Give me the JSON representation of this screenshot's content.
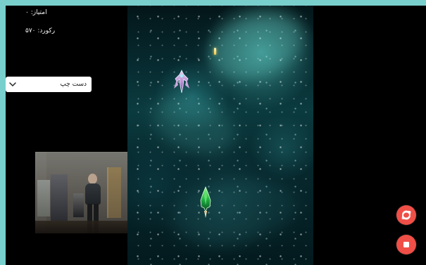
{
  "hud": {
    "score_text": "امتیاز: ۰",
    "record_text": "رکورد: ۵۷۰"
  },
  "controls": {
    "hand_selector": {
      "selected": "دست چپ"
    }
  },
  "icons": {
    "dropdown": "chevron-down-icon",
    "restart": "refresh-icon",
    "stop": "stop-icon"
  },
  "colors": {
    "frame": "#79cfcc",
    "screen_background": "#000000",
    "accent_red": "#ef4f47",
    "player_ship": "#1ba83f",
    "enemy_ship": "#c59bd8",
    "projectile": "#ffc53f"
  }
}
